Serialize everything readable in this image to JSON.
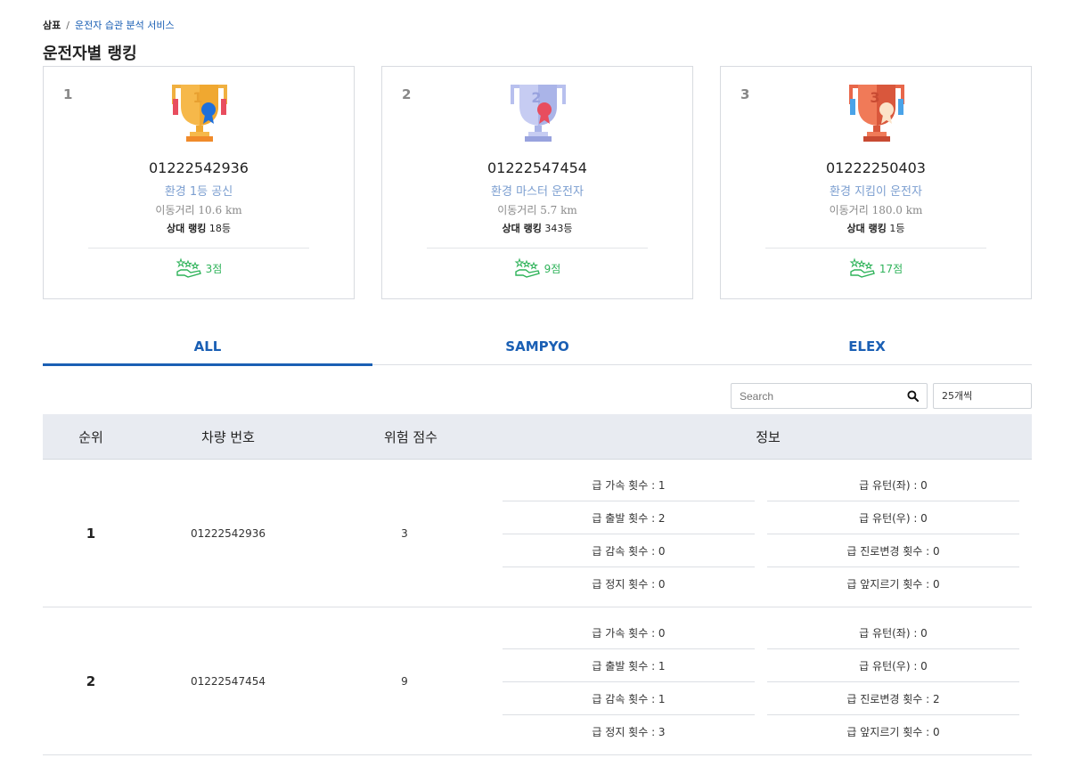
{
  "breadcrumb": {
    "home": "삼표",
    "separator": "/",
    "current": "운전자 습관 분석 서비스"
  },
  "page_title": "운전자별 랭킹",
  "top_cards": [
    {
      "rank": "1",
      "vehicle": "01222542936",
      "title": "환경 1등 공신",
      "distance_label": "이동거리",
      "distance_value": "10.6 km",
      "rel_rank_label": "상대 랭킹",
      "rel_rank_value": "18등",
      "score": "3점",
      "trophy_color": "#f5a623"
    },
    {
      "rank": "2",
      "vehicle": "01222547454",
      "title": "환경 마스터 운전자",
      "distance_label": "이동거리",
      "distance_value": "5.7 km",
      "rel_rank_label": "상대 랭킹",
      "rel_rank_value": "343등",
      "score": "9점",
      "trophy_color": "#aab4e8"
    },
    {
      "rank": "3",
      "vehicle": "01222250403",
      "title": "환경 지킴이 운전자",
      "distance_label": "이동거리",
      "distance_value": "180.0 km",
      "rel_rank_label": "상대 랭킹",
      "rel_rank_value": "1등",
      "score": "17점",
      "trophy_color": "#e8674a"
    }
  ],
  "tabs": [
    {
      "label": "ALL",
      "active": true
    },
    {
      "label": "SAMPYO",
      "active": false
    },
    {
      "label": "ELEX",
      "active": false
    }
  ],
  "search": {
    "placeholder": "Search",
    "value": ""
  },
  "page_size": "25개씩",
  "table": {
    "headers": [
      "순위",
      "차량 번호",
      "위험 점수",
      "정보"
    ],
    "rows": [
      {
        "rank": "1",
        "vehicle": "01222542936",
        "risk": "3",
        "info_left": [
          "급 가속 횟수 : 1",
          "급 출발 횟수 : 2",
          "급 감속 횟수 : 0",
          "급 정지 횟수 : 0"
        ],
        "info_right": [
          "급 유턴(좌) : 0",
          "급 유턴(우) : 0",
          "급 진로변경 횟수 : 0",
          "급 앞지르기 횟수 : 0"
        ]
      },
      {
        "rank": "2",
        "vehicle": "01222547454",
        "risk": "9",
        "info_left": [
          "급 가속 횟수 : 0",
          "급 출발 횟수 : 1",
          "급 감속 횟수 : 1",
          "급 정지 횟수 : 3"
        ],
        "info_right": [
          "급 유턴(좌) : 0",
          "급 유턴(우) : 0",
          "급 진로변경 횟수 : 2",
          "급 앞지르기 횟수 : 0"
        ]
      }
    ]
  },
  "colors": {
    "accent": "#1a5fb4",
    "score_green": "#2fb35a",
    "title_blue": "#7b9ed0",
    "header_bg": "#e8ebf1"
  },
  "icons": {
    "trophy": "trophy-icon",
    "score": "hand-stars-icon",
    "search": "search-icon"
  }
}
